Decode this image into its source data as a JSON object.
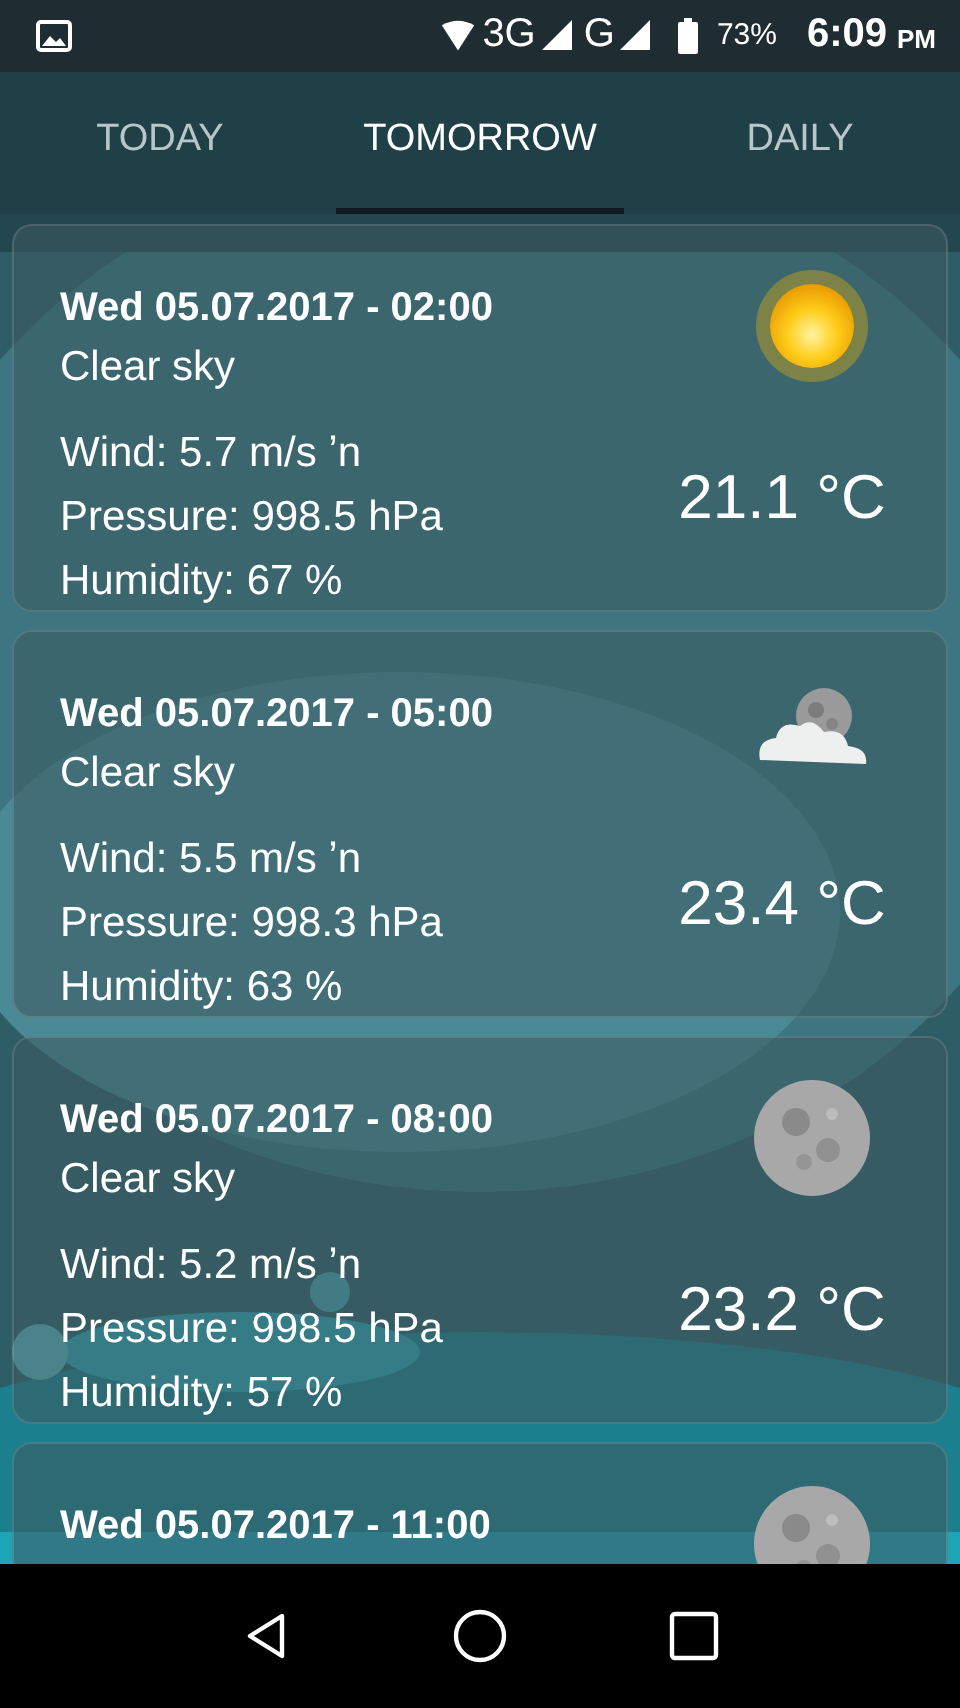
{
  "status_bar": {
    "network_1": "3G",
    "network_2": "G",
    "battery": "73%",
    "time": "6:09",
    "ampm": "PM"
  },
  "tabs": [
    {
      "label": "TODAY",
      "selected": false
    },
    {
      "label": "TOMORROW",
      "selected": true
    },
    {
      "label": "DAILY",
      "selected": false
    }
  ],
  "forecasts": [
    {
      "datetime": "Wed 05.07.2017 - 02:00",
      "description": "Clear sky",
      "wind": "Wind: 5.7 m/s ʼn",
      "pressure": "Pressure: 998.5 hPa",
      "humidity": "Humidity: 67 %",
      "temperature": "21.1 °C",
      "kind": "sun"
    },
    {
      "datetime": "Wed 05.07.2017 - 05:00",
      "description": "Clear sky",
      "wind": "Wind: 5.5 m/s ʼn",
      "pressure": "Pressure: 998.3 hPa",
      "humidity": "Humidity: 63 %",
      "temperature": "23.4 °C",
      "kind": "moon-cloud"
    },
    {
      "datetime": "Wed 05.07.2017 - 08:00",
      "description": "Clear sky",
      "wind": "Wind: 5.2 m/s ʼn",
      "pressure": "Pressure: 998.5 hPa",
      "humidity": "Humidity: 57 %",
      "temperature": "23.2 °C",
      "kind": "moon"
    },
    {
      "datetime": "Wed 05.07.2017 - 11:00",
      "kind": "moon"
    }
  ]
}
